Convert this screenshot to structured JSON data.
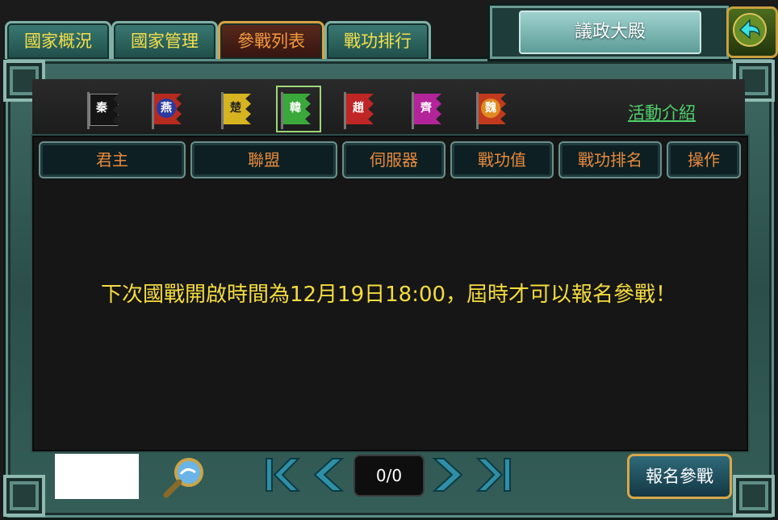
{
  "tabs": [
    {
      "label": "國家概況"
    },
    {
      "label": "國家管理"
    },
    {
      "label": "參戰列表"
    },
    {
      "label": "戰功排行"
    }
  ],
  "active_tab": "參戰列表",
  "title": "議政大殿",
  "flags": [
    {
      "name": "秦",
      "color": "#151515"
    },
    {
      "name": "燕",
      "color": "#b62a20"
    },
    {
      "name": "楚",
      "color": "#d6b321"
    },
    {
      "name": "韓",
      "color": "#3aa83a"
    },
    {
      "name": "趙",
      "color": "#c02626"
    },
    {
      "name": "齊",
      "color": "#b3249a"
    },
    {
      "name": "魏",
      "color": "#c23a1e"
    }
  ],
  "active_flag": "韓",
  "activity_link": "活動介紹",
  "columns": [
    "君主",
    "聯盟",
    "伺服器",
    "戰功值",
    "戰功排名",
    "操作"
  ],
  "notice": "下次國戰開啟時間為12月19日18:00，屆時才可以報名參戰！",
  "pagination": {
    "page": "0/0"
  },
  "signup_button": "報名參戰",
  "colors": {
    "frame": "#3f6a64",
    "tab_text": "#f3e04a",
    "active_tab_text": "#f29a3e",
    "column_text": "#e78a3e",
    "notice_text": "#f4dc3e",
    "link": "#4fd06a"
  }
}
